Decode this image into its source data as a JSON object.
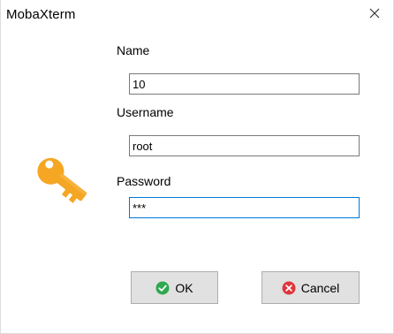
{
  "window": {
    "title": "MobaXterm",
    "close_glyph": "✕"
  },
  "form": {
    "name_label": "Name",
    "name_value": "10",
    "username_label": "Username",
    "username_value": "root",
    "password_label": "Password",
    "password_value": "***"
  },
  "buttons": {
    "ok_label": "OK",
    "cancel_label": "Cancel"
  },
  "icons": {
    "key": "key-icon",
    "ok": "check-circle-icon",
    "cancel": "x-circle-icon",
    "close": "close-icon"
  },
  "colors": {
    "key": "#f5a623",
    "ok_icon": "#2fa84f",
    "cancel_icon": "#e0353d",
    "focus_border": "#0078d7"
  }
}
